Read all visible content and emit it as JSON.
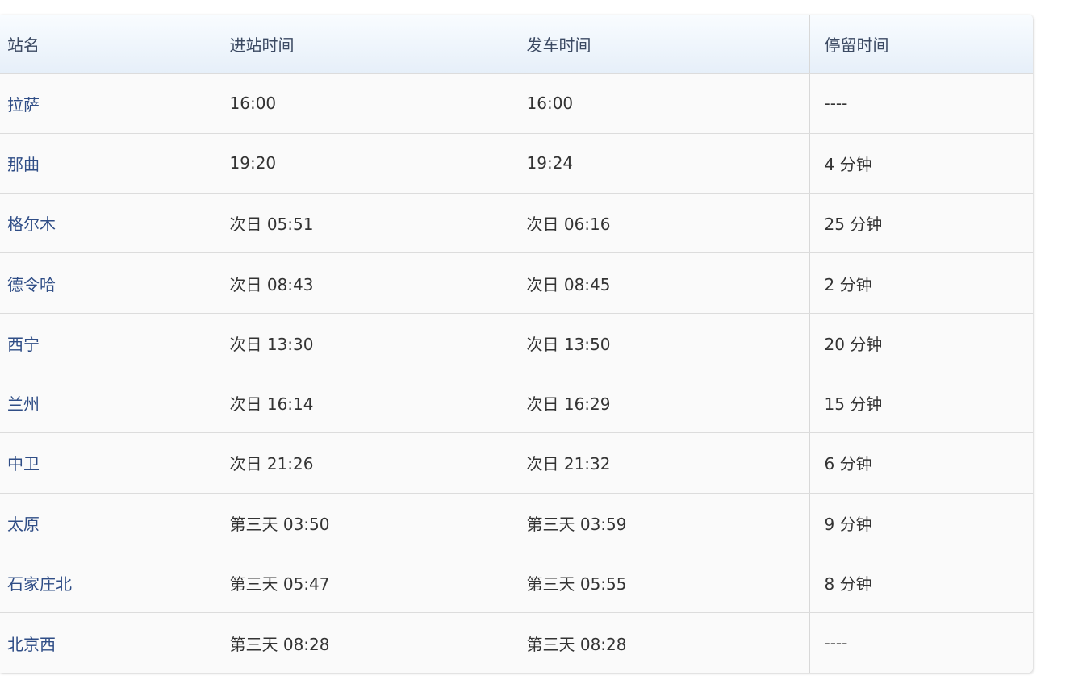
{
  "table": {
    "headers": [
      "站名",
      "进站时间",
      "发车时间",
      "停留时间"
    ],
    "rows": [
      {
        "station": "拉萨",
        "arrive": "16:00",
        "depart": "16:00",
        "stay": "----"
      },
      {
        "station": "那曲",
        "arrive": "19:20",
        "depart": "19:24",
        "stay": "4 分钟"
      },
      {
        "station": "格尔木",
        "arrive": "次日 05:51",
        "depart": "次日 06:16",
        "stay": "25 分钟"
      },
      {
        "station": "德令哈",
        "arrive": "次日 08:43",
        "depart": "次日 08:45",
        "stay": "2 分钟"
      },
      {
        "station": "西宁",
        "arrive": "次日 13:30",
        "depart": "次日 13:50",
        "stay": "20 分钟"
      },
      {
        "station": "兰州",
        "arrive": "次日 16:14",
        "depart": "次日 16:29",
        "stay": "15 分钟"
      },
      {
        "station": "中卫",
        "arrive": "次日 21:26",
        "depart": "次日 21:32",
        "stay": "6 分钟"
      },
      {
        "station": "太原",
        "arrive": "第三天 03:50",
        "depart": "第三天 03:59",
        "stay": "9 分钟"
      },
      {
        "station": "石家庄北",
        "arrive": "第三天 05:47",
        "depart": "第三天 05:55",
        "stay": "8 分钟"
      },
      {
        "station": "北京西",
        "arrive": "第三天 08:28",
        "depart": "第三天 08:28",
        "stay": "----"
      }
    ]
  },
  "colors": {
    "station_link": "#2f4d86",
    "header_text": "#3c4a63",
    "header_bg_top": "#f9fcff",
    "header_bg_bottom": "#e6eff9",
    "row_bg": "#fafafa"
  }
}
